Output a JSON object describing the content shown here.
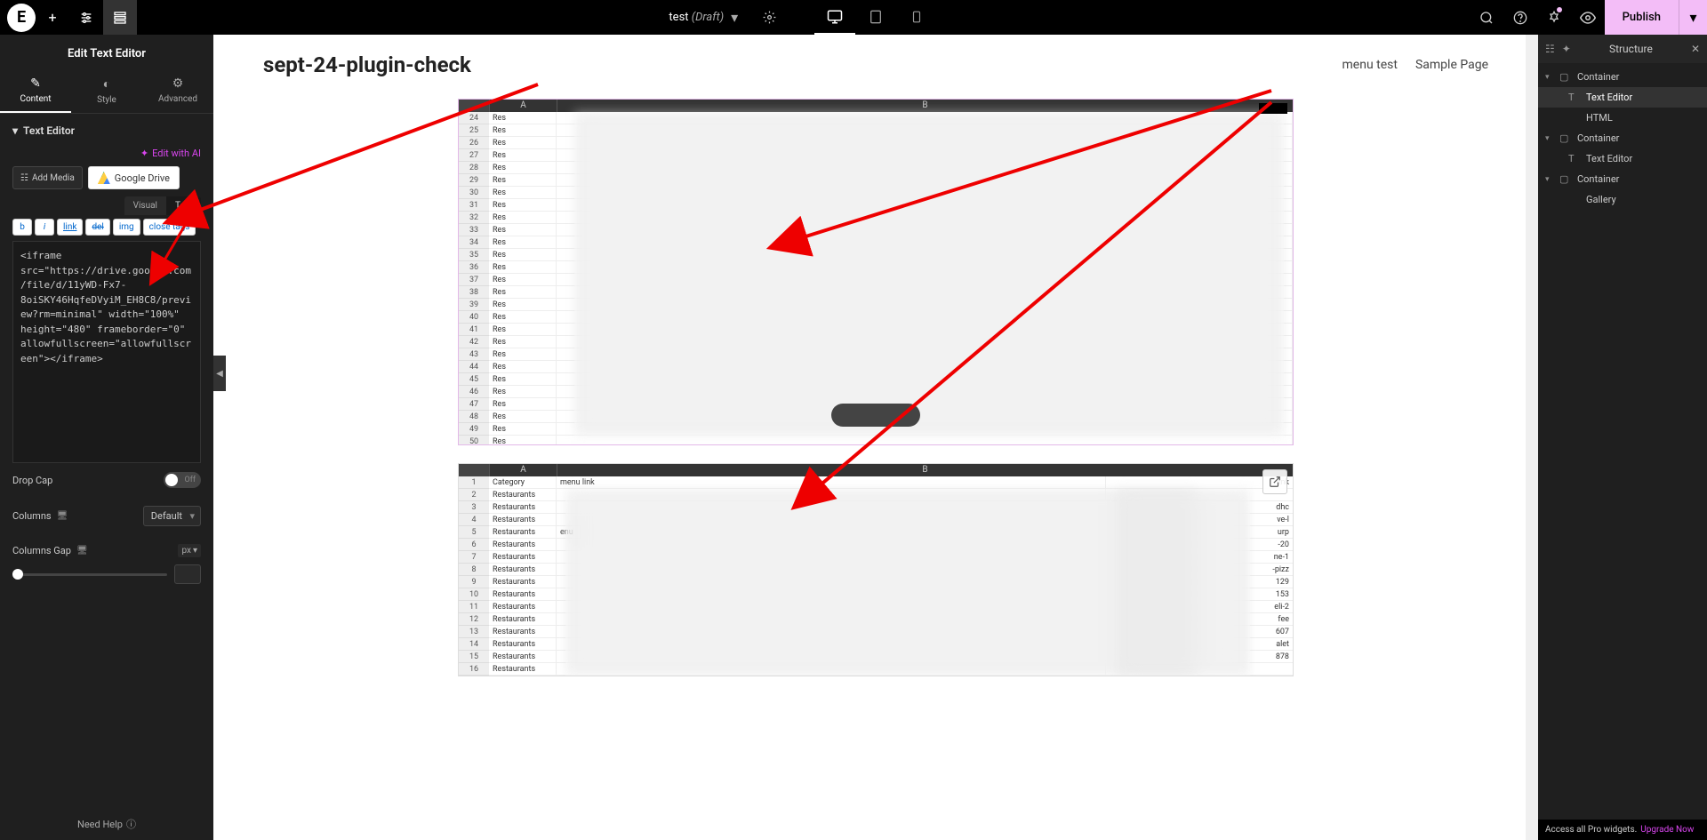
{
  "topbar": {
    "doc_title_prefix": "test",
    "doc_title_suffix": "(Draft)",
    "publish_label": "Publish"
  },
  "left_panel": {
    "title": "Edit Text Editor",
    "tabs": {
      "content": "Content",
      "style": "Style",
      "advanced": "Advanced"
    },
    "section_header": "Text Editor",
    "edit_ai": "Edit with AI",
    "add_media": "Add Media",
    "google_drive": "Google Drive",
    "editor_tabs": {
      "visual": "Visual",
      "text": "Text"
    },
    "toolbar": {
      "b": "b",
      "i": "i",
      "link": "link",
      "del": "del",
      "img": "img",
      "closetags": "close tags"
    },
    "code_text": "<iframe src=\"https://drive.google.com/file/d/11yWD-Fx7-8oiSKY46HqfeDVyiM_EH8C8/preview?rm=minimal\" width=\"100%\" height=\"480\" frameborder=\"0\" allowfullscreen=\"allowfullscreen\"></iframe>",
    "drop_cap": "Drop Cap",
    "drop_cap_state": "Off",
    "columns_label": "Columns",
    "columns_value": "Default",
    "columns_gap": "Columns Gap",
    "columns_gap_unit": "px",
    "need_help": "Need Help"
  },
  "canvas": {
    "page_title": "sept-24-plugin-check",
    "links": {
      "menu_test": "menu test",
      "sample_page": "Sample Page"
    },
    "sheet1": {
      "cols": {
        "a": "A",
        "b": "B"
      },
      "row_start": 24,
      "row_end": 50,
      "cell_a_prefix": "Res"
    },
    "sheet2": {
      "cols": {
        "a": "A",
        "b": "B"
      },
      "row_start": 1,
      "row_end": 16,
      "headers": {
        "category": "Category",
        "menu_link": "menu link",
        "link": "link"
      },
      "cat_value": "Restaurants",
      "menu_suffix": "enu",
      "link_fragments": [
        "",
        "dhc",
        "ve-l",
        "urp",
        "-20",
        "ne-1",
        "-pizz",
        "129",
        "153",
        "eli-2",
        "fee",
        "607",
        "alet",
        "878",
        ""
      ]
    }
  },
  "navigator": {
    "title": "Structure",
    "tree": [
      {
        "label": "Container",
        "icon": "▢",
        "depth": 0,
        "caret": "▾",
        "selected": false
      },
      {
        "label": "Text Editor",
        "icon": "T",
        "depth": 1,
        "caret": "",
        "selected": true
      },
      {
        "label": "HTML",
        "icon": "</>",
        "depth": 1,
        "caret": "",
        "selected": false
      },
      {
        "label": "Container",
        "icon": "▢",
        "depth": 0,
        "caret": "▾",
        "selected": false
      },
      {
        "label": "Text Editor",
        "icon": "T",
        "depth": 1,
        "caret": "",
        "selected": false
      },
      {
        "label": "Container",
        "icon": "▢",
        "depth": 0,
        "caret": "▾",
        "selected": false
      },
      {
        "label": "Gallery",
        "icon": "",
        "depth": 1,
        "caret": "",
        "selected": false
      }
    ],
    "pro_text": "Access all Pro widgets.",
    "pro_link": "Upgrade Now"
  }
}
